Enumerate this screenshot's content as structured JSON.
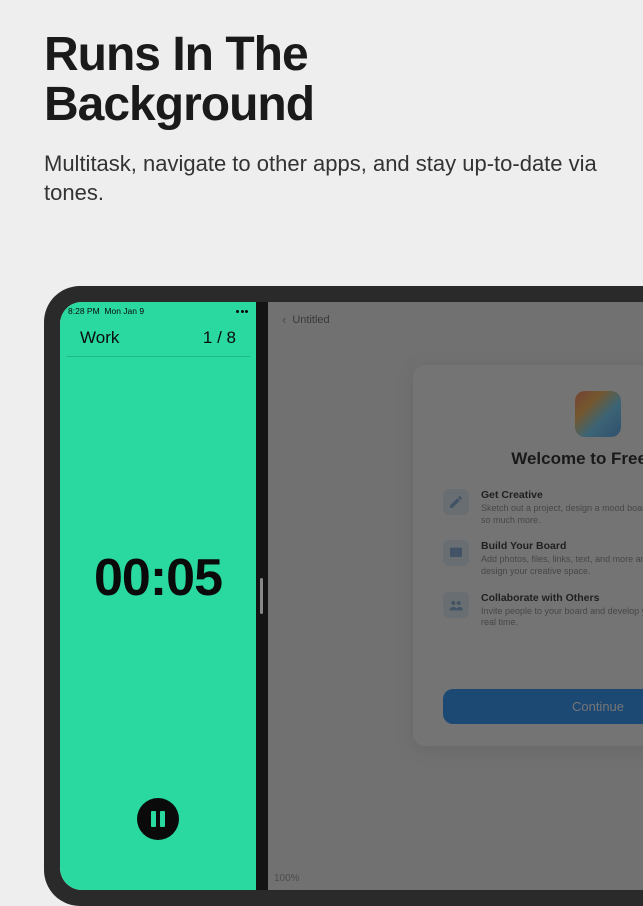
{
  "hero": {
    "title_line1": "Runs In The",
    "title_line2": "Background",
    "subtitle": "Multitask, navigate to other apps, and stay up-to-date via tones."
  },
  "status": {
    "time": "8:28 PM",
    "date": "Mon Jan 9"
  },
  "timer": {
    "label": "Work",
    "counter": "1 / 8",
    "display": "00:05"
  },
  "freeform": {
    "doc_title": "Untitled",
    "welcome_title": "Welcome to Freeform",
    "items": [
      {
        "title": "Get Creative",
        "desc": "Sketch out a project, design a mood board, brainstorm ideas, and so much more."
      },
      {
        "title": "Build Your Board",
        "desc": "Add photos, files, links, text, and more anywhere on a board to design your creative space."
      },
      {
        "title": "Collaborate with Others",
        "desc": "Invite people to your board and develop your best ideas together in real time."
      }
    ],
    "continue_label": "Continue",
    "zoom": "100%"
  }
}
